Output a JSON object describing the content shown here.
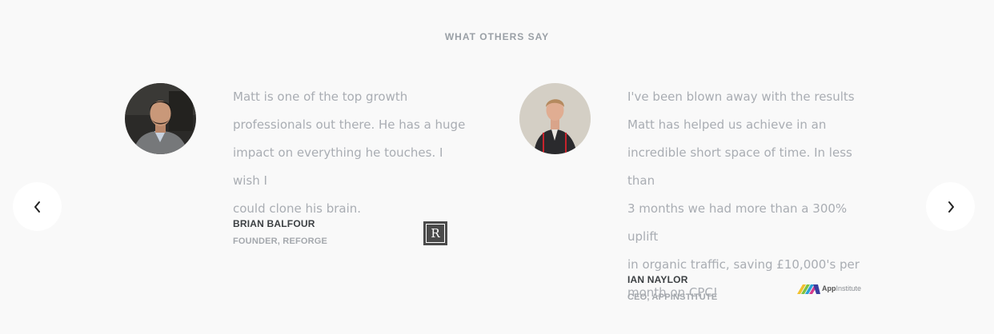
{
  "section": {
    "title": "WHAT OTHERS SAY"
  },
  "navigation": {
    "prev_icon": "chevron-left-icon",
    "next_icon": "chevron-right-icon"
  },
  "testimonials": [
    {
      "quote_lines": [
        "Matt is one of the top growth",
        "professionals out there. He has a huge",
        "impact on everything he touches. I wish I",
        "could clone his brain."
      ],
      "author": "BRIAN BALFOUR",
      "role": "FOUNDER, REFORGE",
      "logo": {
        "icon": "reforge-logo",
        "text": "R"
      }
    },
    {
      "quote_lines": [
        "I've been blown away with the results",
        "Matt has helped us achieve in an",
        "incredible short space of time. In less than",
        "3 months we had more than a 300% uplift",
        "in organic traffic, saving £10,000's per",
        "month on CPC!"
      ],
      "author": "IAN NAYLOR",
      "role": "CEO, APPINSTITUTE",
      "logo": {
        "icon": "appinstitute-logo",
        "text_bold": "App",
        "text_light": "Institute"
      }
    }
  ],
  "colors": {
    "background": "#f9f9f9",
    "quote_text": "#a9adb3",
    "name_text": "#3c4043",
    "role_text": "#a4a8ad"
  }
}
